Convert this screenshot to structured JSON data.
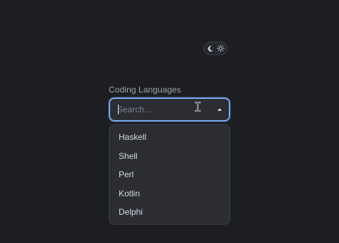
{
  "theme_toggle": {
    "icons": [
      "moon-icon",
      "sun-icon"
    ]
  },
  "combobox": {
    "label": "Coding Languages",
    "placeholder": "Search...",
    "value": "",
    "toggle_icon": "caret-up-icon",
    "options": [
      {
        "label": "Haskell"
      },
      {
        "label": "Shell"
      },
      {
        "label": "Perl"
      },
      {
        "label": "Kotlin"
      },
      {
        "label": "Delphi"
      }
    ]
  },
  "colors": {
    "background": "#1d1e22",
    "focus_ring": "#78a6ec",
    "surface": "#2b2d33"
  }
}
